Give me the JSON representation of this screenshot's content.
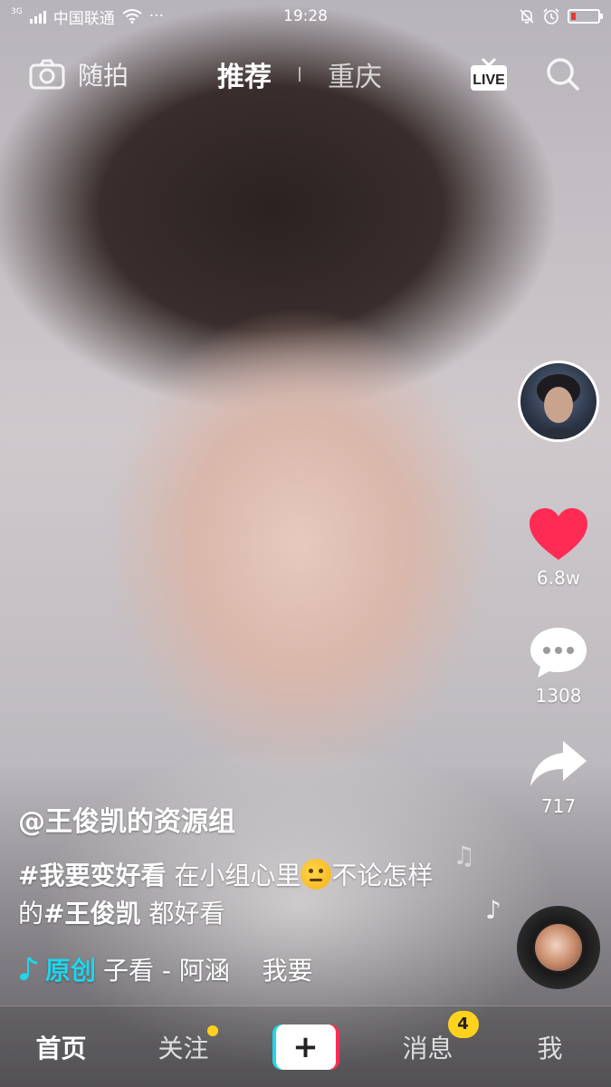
{
  "status_bar": {
    "network": "3G",
    "carrier": "中国联通",
    "more": "···",
    "time": "19:28",
    "battery_level": 0.18
  },
  "top_nav": {
    "camera_label": "随拍",
    "tabs": [
      {
        "label": "推荐",
        "active": true
      },
      {
        "label": "重庆",
        "active": false
      }
    ],
    "live_label": "LIVE"
  },
  "actions": {
    "like_count": "6.8w",
    "comment_count": "1308",
    "share_count": "717"
  },
  "caption": {
    "author": "@王俊凯的资源组",
    "hashtag_1": "#我要变好看",
    "text_1": " 在小组心里",
    "text_2": "不论怎样的",
    "hashtag_2": "#王俊凯",
    "text_3": " 都好看"
  },
  "music": {
    "tag": "原创",
    "text": "子看 - 阿涵    我要"
  },
  "tabbar": {
    "home": "首页",
    "follow": "关注",
    "create": "+",
    "messages": "消息",
    "messages_badge": "4",
    "me": "我"
  },
  "colors": {
    "like": "#fe2c55",
    "accent_cyan": "#20d5ec",
    "badge": "#ffd21e"
  }
}
